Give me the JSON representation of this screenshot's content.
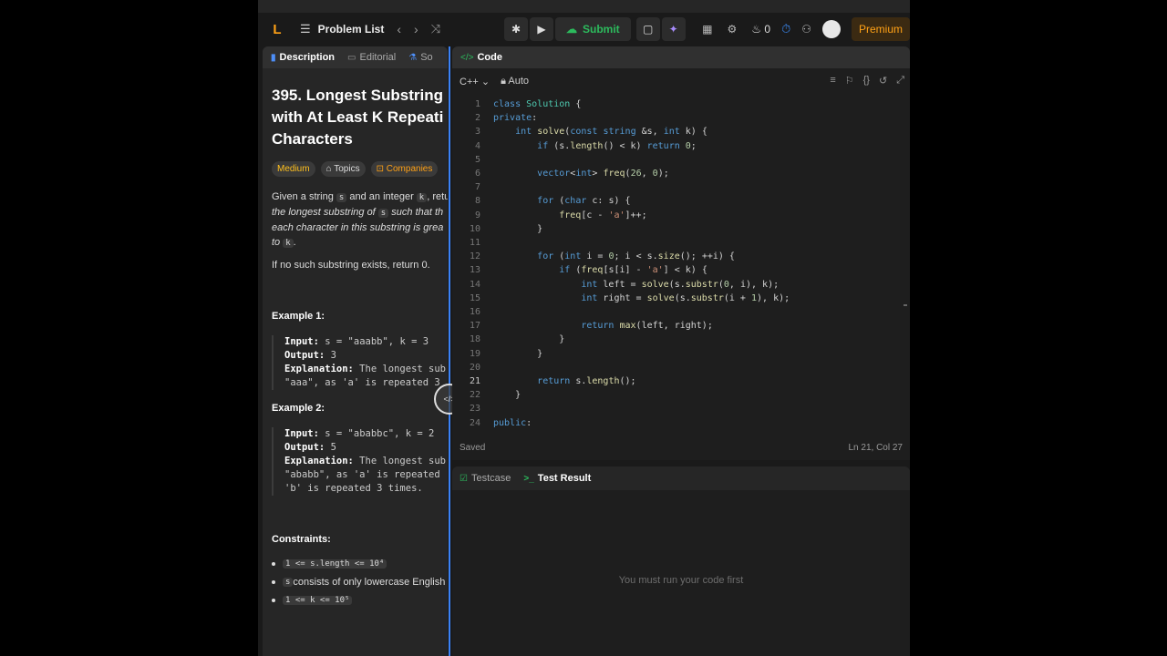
{
  "navbar": {
    "logo": "L",
    "problem_list": "Problem List",
    "submit": "Submit",
    "fire_count": "0",
    "premium": "Premium"
  },
  "left_tabs": [
    "Description",
    "Editorial",
    "So"
  ],
  "problem": {
    "title_lines": [
      "395. Longest Substring",
      "with At Least K Repeati",
      "Characters"
    ],
    "badges": {
      "difficulty": "Medium",
      "topics": "Topics",
      "companies": "Companies"
    },
    "desc_lines": {
      "l1_a": "Given a string ",
      "l1_code1": "s",
      "l1_b": " and an integer ",
      "l1_code2": "k",
      "l1_c": ", retu",
      "l2_a": "the longest substring of ",
      "l2_code": "s",
      "l2_b": " such that th",
      "l3": "each character in this substring is grea",
      "l4_a": "to ",
      "l4_code": "k",
      "l4_b": "."
    },
    "no_substring": "If no such substring exists, return 0.",
    "example1": {
      "heading": "Example 1:",
      "input_label": "Input:",
      "input_value": " s = \"aaabb\", k = 3",
      "output_label": "Output:",
      "output_value": " 3",
      "expl_label": "Explanation:",
      "expl_value": " The longest sub",
      "expl_line2": "\"aaa\", as 'a' is repeated 3"
    },
    "example2": {
      "heading": "Example 2:",
      "input_label": "Input:",
      "input_value": " s = \"ababbc\", k = 2",
      "output_label": "Output:",
      "output_value": " 5",
      "expl_label": "Explanation:",
      "expl_value": " The longest sub",
      "expl_line2": "\"ababb\", as 'a' is repeated",
      "expl_line3": "'b' is repeated 3 times."
    },
    "constraints_heading": "Constraints:",
    "constraints": {
      "c1_code": "1 <= s.length <= 10⁴",
      "c2_code": "s",
      "c2_text": " consists of only lowercase English",
      "c3_code": "1 <= k <= 10⁵"
    }
  },
  "code_panel": {
    "tab": "Code",
    "language": "C++",
    "mode": "Auto",
    "status": "Saved",
    "cursor": "Ln 21, Col 27"
  },
  "code_lines": [
    "class Solution {",
    "private:",
    "    int solve(const string &s, int k) {",
    "        if (s.length() < k) return 0;",
    "",
    "        vector<int> freq(26, 0);",
    "",
    "        for (char c: s) {",
    "            freq[c - 'a']++;",
    "        }",
    "",
    "        for (int i = 0; i < s.size(); ++i) {",
    "            if (freq[s[i] - 'a'] < k) {",
    "                int left = solve(s.substr(0, i), k);",
    "                int right = solve(s.substr(i + 1), k);",
    "",
    "                return max(left, right);",
    "            }",
    "        }",
    "",
    "        return s.length();",
    "    }",
    "",
    "public:"
  ],
  "test_panel": {
    "tabs": [
      "Testcase",
      "Test Result"
    ],
    "message": "You must run your code first"
  },
  "colors": {
    "accent": "#ffa116",
    "submit": "#2cbb5d",
    "divider": "#3b82f6",
    "difficulty": "#ffc01e"
  }
}
